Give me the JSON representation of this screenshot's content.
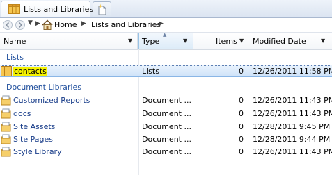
{
  "tab": {
    "label": "Lists and Libraries"
  },
  "breadcrumb": [
    "Home",
    "Lists and Libraries"
  ],
  "columns": [
    {
      "label": "Name"
    },
    {
      "label": "Type"
    },
    {
      "label": "Items"
    },
    {
      "label": "Modified Date"
    }
  ],
  "groups": [
    {
      "label": "Lists",
      "rows": [
        {
          "name": "contacts",
          "type": "Lists",
          "items": "0",
          "modified": "12/26/2011 11:58 PM",
          "selected": true
        }
      ]
    },
    {
      "label": "Document Libraries",
      "rows": [
        {
          "name": "Customized Reports",
          "type": "Document ...",
          "items": "0",
          "modified": "12/26/2011 11:43 PM"
        },
        {
          "name": "docs",
          "type": "Document ...",
          "items": "0",
          "modified": "12/26/2011 11:43 PM"
        },
        {
          "name": "Site Assets",
          "type": "Document ...",
          "items": "0",
          "modified": "12/28/2011 9:45 PM"
        },
        {
          "name": "Site Pages",
          "type": "Document ...",
          "items": "0",
          "modified": "12/28/2011 9:44 PM"
        },
        {
          "name": "Style Library",
          "type": "Document ...",
          "items": "0",
          "modified": "12/26/2011 11:43 PM"
        }
      ]
    }
  ],
  "colors": {
    "group_header": "#1f4e9c",
    "link": "#1a3e8a",
    "selection": "#cfe3f8",
    "highlight": "#f5f200"
  }
}
